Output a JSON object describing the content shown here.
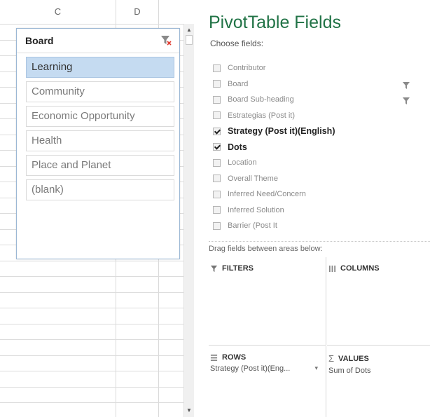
{
  "sheet": {
    "columns": [
      "C",
      "D",
      ""
    ]
  },
  "slicer": {
    "title": "Board",
    "items": [
      {
        "label": "Learning",
        "selected": true
      },
      {
        "label": "Community",
        "selected": false
      },
      {
        "label": "Economic Opportunity",
        "selected": false
      },
      {
        "label": "Health",
        "selected": false
      },
      {
        "label": "Place and Planet",
        "selected": false
      },
      {
        "label": "(blank)",
        "selected": false
      }
    ]
  },
  "pane": {
    "title": "PivotTable Fields",
    "choose_label": "Choose fields:",
    "fields": [
      {
        "label": "Contributor",
        "checked": false,
        "filtered": false
      },
      {
        "label": "Board",
        "checked": false,
        "filtered": true
      },
      {
        "label": "Board Sub-heading",
        "checked": false,
        "filtered": true
      },
      {
        "label": "Estrategias (Post it)",
        "checked": false,
        "filtered": false
      },
      {
        "label": "Strategy (Post it)(English)",
        "checked": true,
        "filtered": false
      },
      {
        "label": "Dots",
        "checked": true,
        "filtered": false
      },
      {
        "label": "Location",
        "checked": false,
        "filtered": false
      },
      {
        "label": "Overall Theme",
        "checked": false,
        "filtered": false
      },
      {
        "label": "Inferred Need/Concern",
        "checked": false,
        "filtered": false
      },
      {
        "label": "Inferred Solution",
        "checked": false,
        "filtered": false
      },
      {
        "label": "Barrier (Post It",
        "checked": false,
        "filtered": false
      }
    ],
    "drag_label": "Drag fields between areas below:",
    "areas": {
      "filters": {
        "label": "FILTERS"
      },
      "columns": {
        "label": "COLUMNS"
      },
      "rows": {
        "label": "ROWS",
        "item": "Strategy (Post it)(Eng..."
      },
      "values": {
        "label": "VALUES",
        "item": "Sum of Dots"
      }
    }
  },
  "colors": {
    "accent_green": "#217346",
    "slicer_selected": "#c5dbf1",
    "clear_filter_red": "#e03c31"
  }
}
